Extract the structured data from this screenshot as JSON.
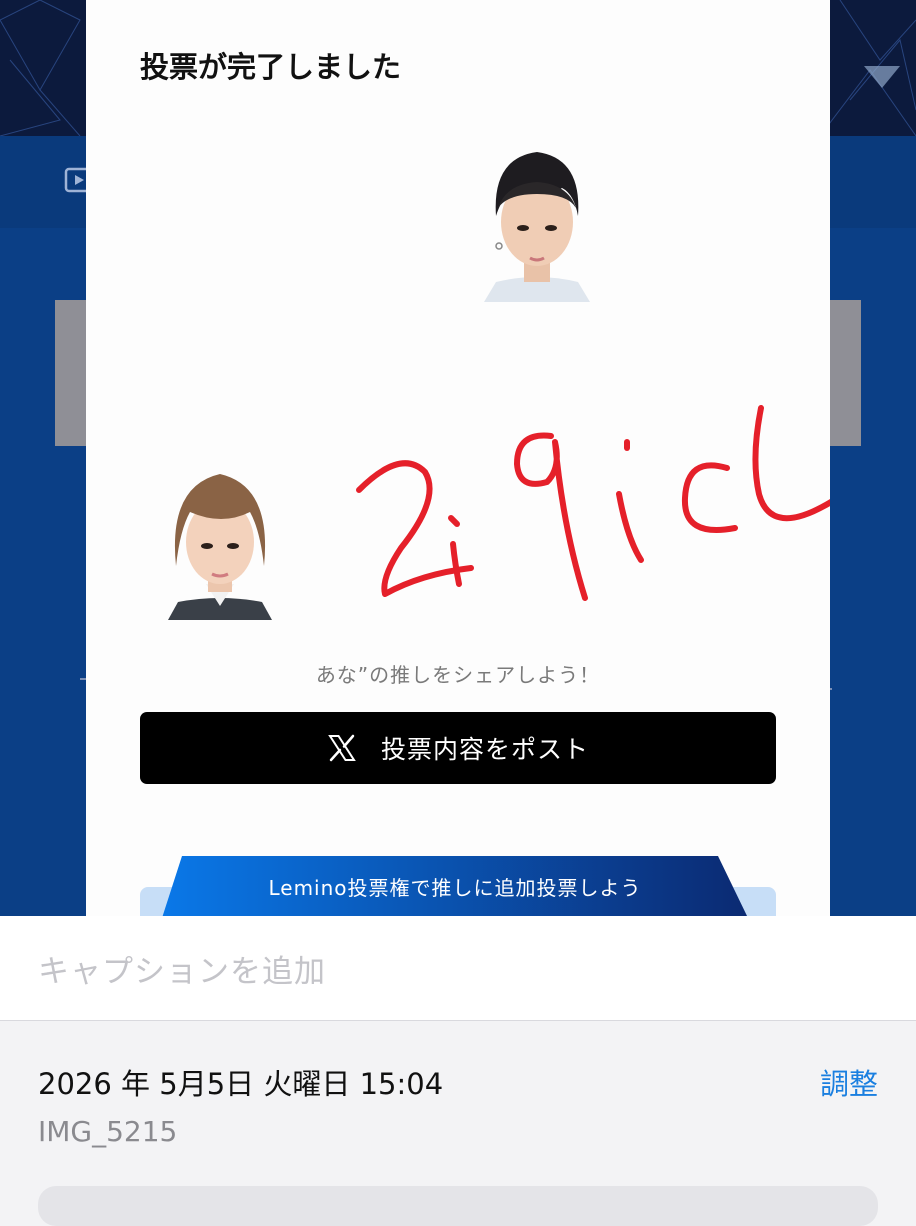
{
  "modal": {
    "title": "投票が完了しました",
    "share_prompt": "あな”の推しをシェアしよう！",
    "post_button_label": "投票内容をポスト",
    "lemino_banner_label": "Lemino投票権で推しに追加投票しよう",
    "handwritten_overlay": "2i9icl"
  },
  "caption": {
    "placeholder": "キャプションを追加"
  },
  "info": {
    "datetime": "2026 年 5月5日 火曜日 15:04",
    "adjust_label": "調整",
    "filename": "IMG_5215"
  },
  "colors": {
    "background_app": "#0b3f86",
    "banner_dark": "#0c1a3d",
    "post_button": "#000000",
    "lemino_gradient_start": "#0a78e8",
    "lemino_gradient_end": "#0b2a72",
    "lemino_tab": "#c7def7",
    "adjust_link": "#1a7fe0",
    "scribble": "#e5202a"
  },
  "icons": [
    "play-icon",
    "x-logo-icon"
  ]
}
